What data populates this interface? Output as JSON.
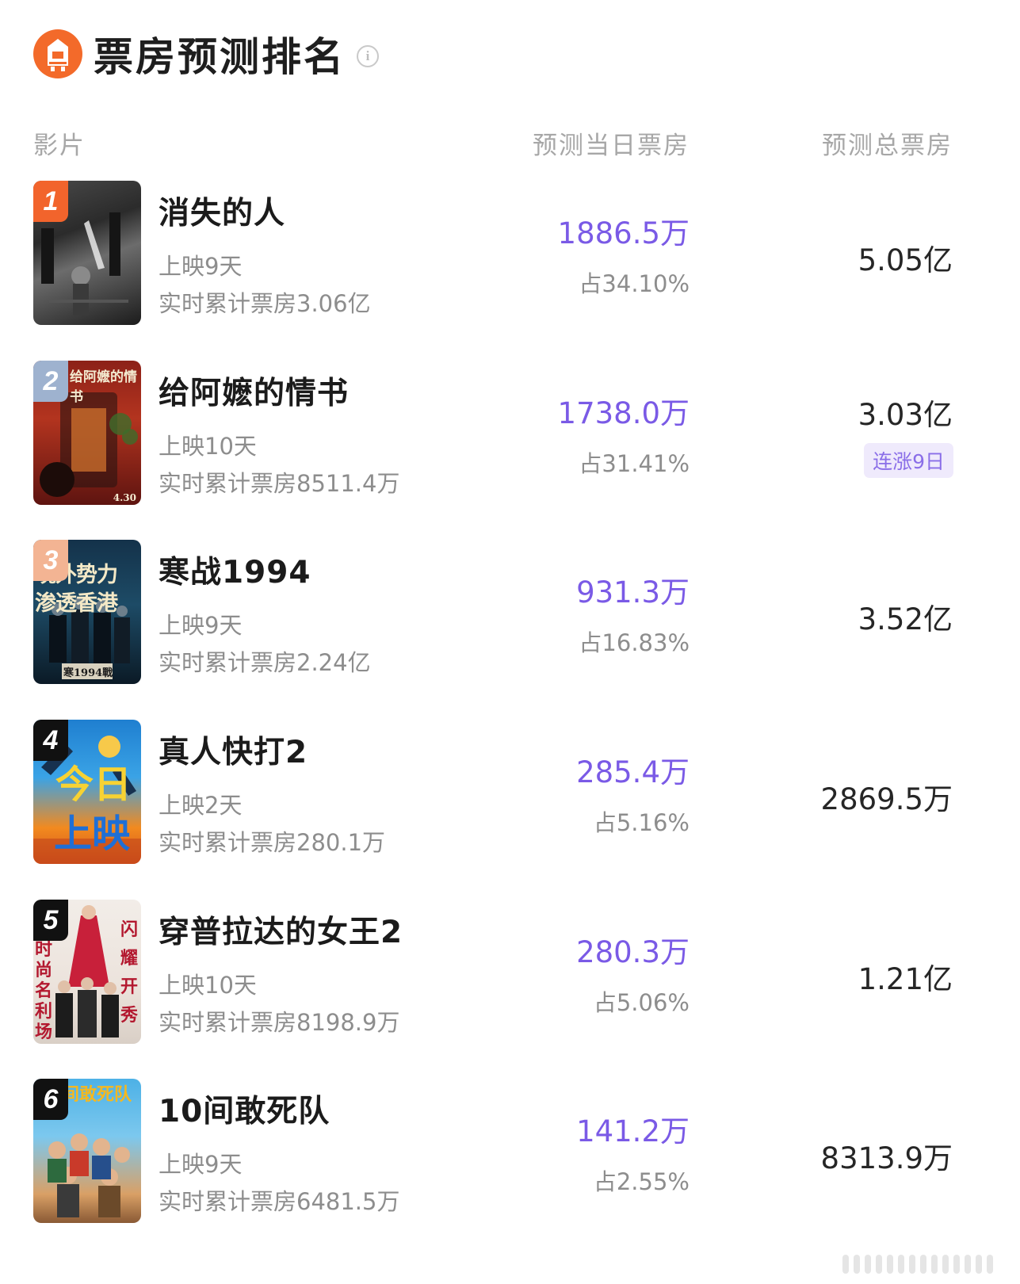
{
  "header": {
    "title": "票房预测排名",
    "info_icon": "info-icon",
    "logo_icon": "cinema-logo-icon"
  },
  "columns": {
    "film": "影片",
    "daily": "预测当日票房",
    "total": "预测总票房"
  },
  "colors": {
    "accent": "#7a5ae6",
    "rank1": "#f2642c",
    "rank2": "#9eb2cf",
    "rank3": "#f3b493",
    "rank_other": "#111111",
    "badge_bg": "#efeafc"
  },
  "films": [
    {
      "rank": "1",
      "title": "消失的人",
      "days": "上映9天",
      "cumulative": "实时累计票房3.06亿",
      "daily": "1886.5万",
      "share": "占34.10%",
      "total": "5.05亿",
      "badge": ""
    },
    {
      "rank": "2",
      "title": "给阿嬷的情书",
      "days": "上映10天",
      "cumulative": "实时累计票房8511.4万",
      "daily": "1738.0万",
      "share": "占31.41%",
      "total": "3.03亿",
      "badge": "连涨9日",
      "poster_text": "给阿嬷的情书",
      "poster_date": "4.30"
    },
    {
      "rank": "3",
      "title": "寒战1994",
      "days": "上映9天",
      "cumulative": "实时累计票房2.24亿",
      "daily": "931.3万",
      "share": "占16.83%",
      "total": "3.52亿",
      "badge": "",
      "poster_text_1": "境外势力",
      "poster_text_2": "渗透香港",
      "poster_text_3": "寒1994戰"
    },
    {
      "rank": "4",
      "title": "真人快打2",
      "days": "上映2天",
      "cumulative": "实时累计票房280.1万",
      "daily": "285.4万",
      "share": "占5.16%",
      "total": "2869.5万",
      "badge": "",
      "poster_text_1": "今日",
      "poster_text_2": "上映"
    },
    {
      "rank": "5",
      "title": "穿普拉达的女王2",
      "days": "上映10天",
      "cumulative": "实时累计票房8198.9万",
      "daily": "280.3万",
      "share": "占5.06%",
      "total": "1.21亿",
      "badge": "",
      "poster_text_left": "时尚名利场",
      "poster_text_right": "闪耀开秀"
    },
    {
      "rank": "6",
      "title": "10间敢死队",
      "days": "上映9天",
      "cumulative": "实时累计票房6481.5万",
      "daily": "141.2万",
      "share": "占2.55%",
      "total": "8313.9万",
      "badge": "",
      "poster_text": "间敢死队"
    }
  ]
}
